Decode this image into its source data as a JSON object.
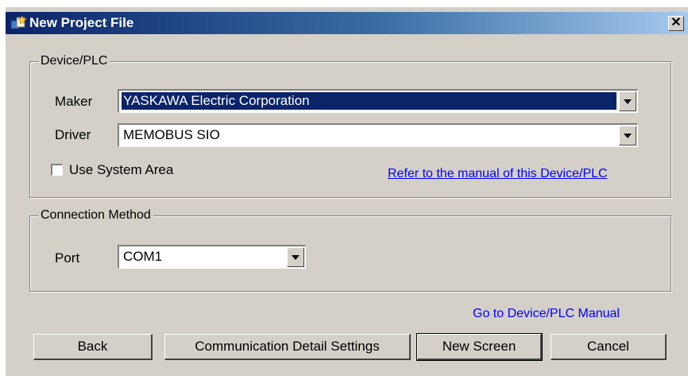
{
  "window": {
    "title": "New Project File",
    "close_glyph": "✕",
    "icon": "new-project-icon"
  },
  "device_group": {
    "legend": "Device/PLC",
    "maker_label": "Maker",
    "maker_value": "YASKAWA Electric Corporation",
    "driver_label": "Driver",
    "driver_value": "MEMOBUS SIO",
    "use_system_area_label": "Use System Area",
    "use_system_area_checked": false,
    "manual_link": "Refer to the manual of this Device/PLC"
  },
  "connection_group": {
    "legend": "Connection Method",
    "port_label": "Port",
    "port_value": "COM1"
  },
  "footer": {
    "manual_link": "Go to Device/PLC Manual",
    "back_label": "Back",
    "comm_settings_label": "Communication Detail Settings",
    "new_screen_label": "New Screen",
    "cancel_label": "Cancel"
  },
  "colors": {
    "titlebar_start": "#0a246a",
    "titlebar_end": "#a6caf0",
    "face": "#d4d0c8",
    "selection": "#0a246a",
    "link": "#0000ff"
  }
}
